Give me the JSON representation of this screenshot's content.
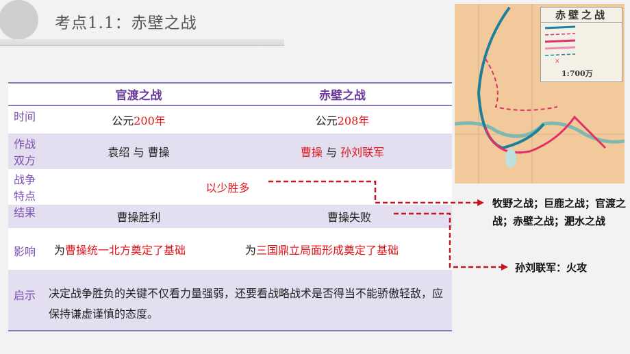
{
  "header": {
    "title": "考点1.1：赤壁之战"
  },
  "table": {
    "columns": [
      "",
      "官渡之战",
      "赤壁之战"
    ],
    "rows": [
      {
        "label": "时间",
        "guandu": {
          "prefix": "公元",
          "highlight": "200年"
        },
        "chibi": {
          "prefix": "公元",
          "highlight": "208年"
        }
      },
      {
        "label": "作战双方",
        "guandu": "袁绍 与 曹操",
        "chibi": {
          "a": "曹操",
          "mid": " 与 ",
          "b": "孙刘联军"
        }
      },
      {
        "label": "战争特点",
        "merged": "以少胜多"
      },
      {
        "label": "结果",
        "guandu": "曹操胜利",
        "chibi": "曹操失败"
      },
      {
        "label": "影响",
        "guandu": {
          "prefix": "为",
          "highlight": "曹操统一北方奠定了基础"
        },
        "chibi": {
          "prefix": "为",
          "highlight": "三国鼎立局面形成奠定了基础"
        }
      },
      {
        "label": "启示",
        "merged": "决定战争胜负的关键不仅看力量强弱，还要看战略战术是否得当不能骄傲轻敌，应保持谦虚谨慎的态度。"
      }
    ]
  },
  "map": {
    "title": "赤壁之战",
    "scale": "1:700万"
  },
  "notes": {
    "battles": "牧野之战；巨鹿之战；官渡之战；赤壁之战；淝水之战",
    "tactic": "孙刘联军：火攻"
  },
  "colors": {
    "accent": "#e0151b",
    "label": "#7a4fb0",
    "row_alt": "#e4dff0",
    "dash": "#c0161c"
  }
}
